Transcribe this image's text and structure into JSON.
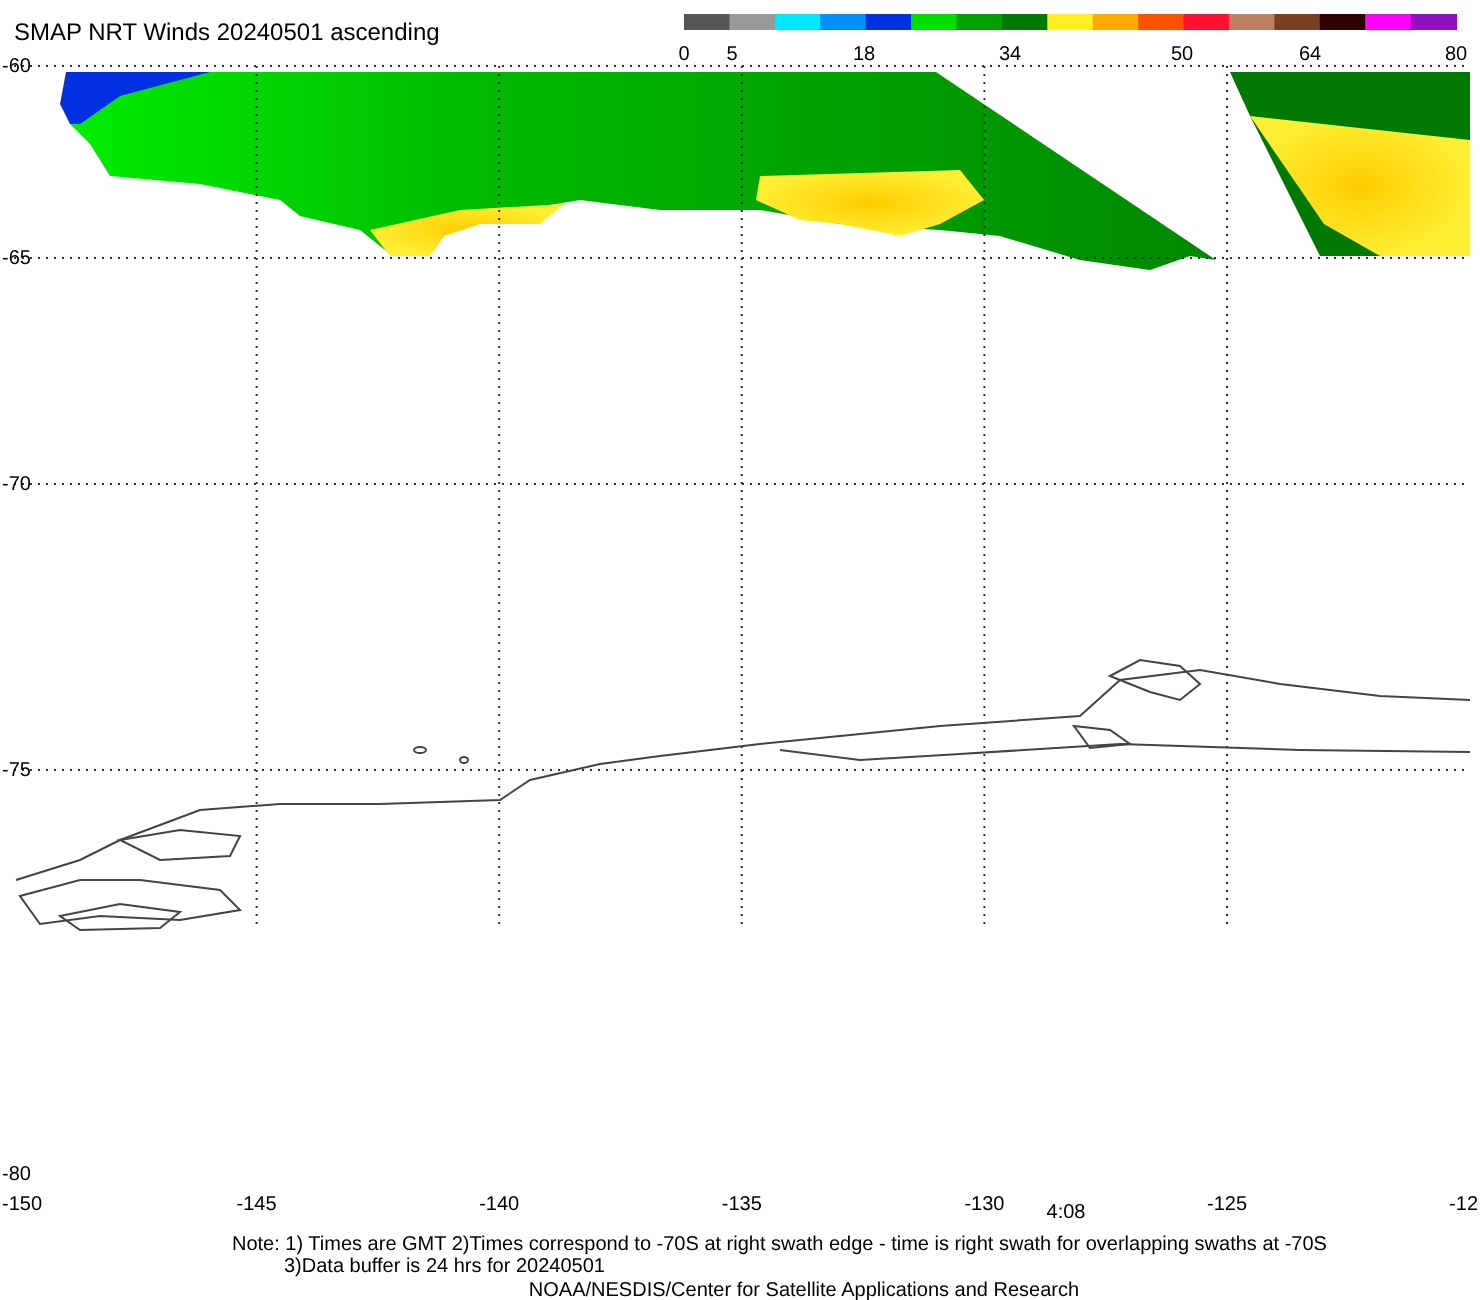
{
  "title": "SMAP NRT Winds 20240501 ascending",
  "colorbar": {
    "bands": [
      {
        "color": "#555555"
      },
      {
        "color": "#999999"
      },
      {
        "color": "#00e8ff"
      },
      {
        "color": "#0090ff"
      },
      {
        "color": "#0030e0"
      },
      {
        "color": "#00e000"
      },
      {
        "color": "#00a000"
      },
      {
        "color": "#007a00"
      },
      {
        "color": "#ffee22"
      },
      {
        "color": "#ffaa00"
      },
      {
        "color": "#ff5000"
      },
      {
        "color": "#ff1030"
      },
      {
        "color": "#c08060"
      },
      {
        "color": "#7a4020"
      },
      {
        "color": "#300000"
      },
      {
        "color": "#ff00ff"
      },
      {
        "color": "#9010c0"
      }
    ],
    "labels": [
      "0",
      "5",
      "18",
      "34",
      "50",
      "64",
      "80"
    ]
  },
  "lat_labels": [
    "-60",
    "-65",
    "-70",
    "-75",
    "-80"
  ],
  "lon_labels": [
    "-150",
    "-145",
    "-140",
    "-135",
    "-130",
    "-125",
    "-12"
  ],
  "time_label": "4:08",
  "notes": [
    "Note: 1) Times are GMT 2)Times correspond to -70S at right swath edge - time is right swath for overlapping swaths at -70S",
    "3)Data buffer is 24 hrs for 20240501"
  ],
  "credit": "NOAA/NESDIS/Center for Satellite Applications and Research"
}
